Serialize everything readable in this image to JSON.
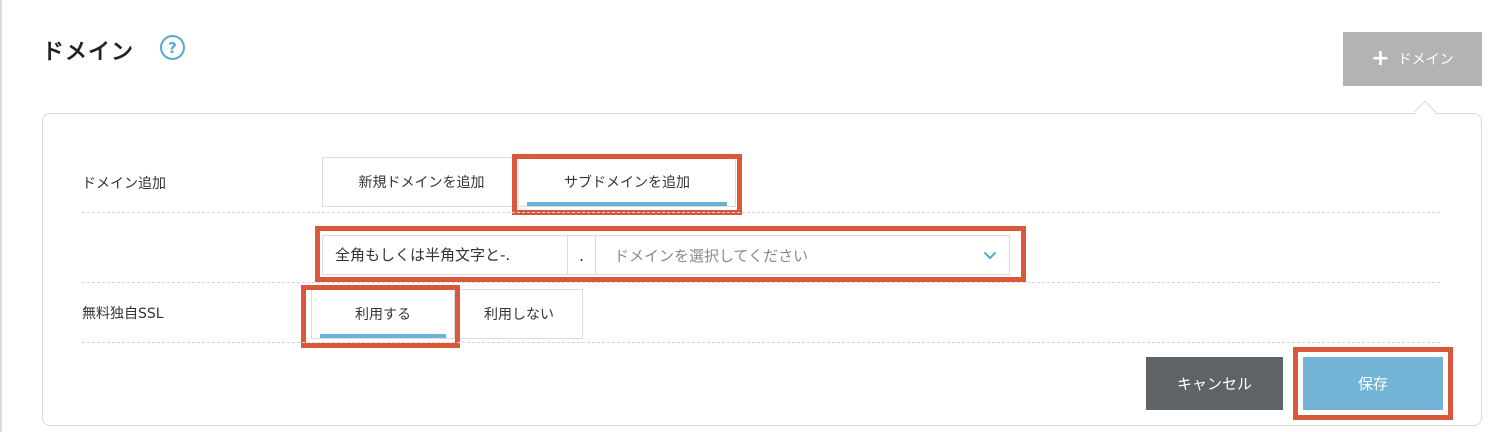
{
  "header": {
    "title": "ドメイン",
    "help_icon": "question-circle-icon",
    "add_button_label": "ドメイン",
    "add_button_icon": "plus-icon"
  },
  "form": {
    "domain_add": {
      "label": "ドメイン追加",
      "tabs": [
        {
          "label": "新規ドメインを追加",
          "active": false
        },
        {
          "label": "サブドメインを追加",
          "active": true
        }
      ]
    },
    "subdomain": {
      "input_placeholder": "全角もしくは半角文字と-.",
      "separator": ".",
      "select_placeholder": "ドメインを選択してください"
    },
    "ssl": {
      "label": "無料独自SSL",
      "tabs": [
        {
          "label": "利用する",
          "active": true
        },
        {
          "label": "利用しない",
          "active": false
        }
      ]
    },
    "actions": {
      "cancel_label": "キャンセル",
      "save_label": "保存"
    }
  },
  "colors": {
    "accent": "#6ab3d6",
    "highlight": "#d9573a",
    "cancel_bg": "#5f6366",
    "save_bg": "#72b3d6",
    "add_button_bg": "#b3b3b3"
  }
}
